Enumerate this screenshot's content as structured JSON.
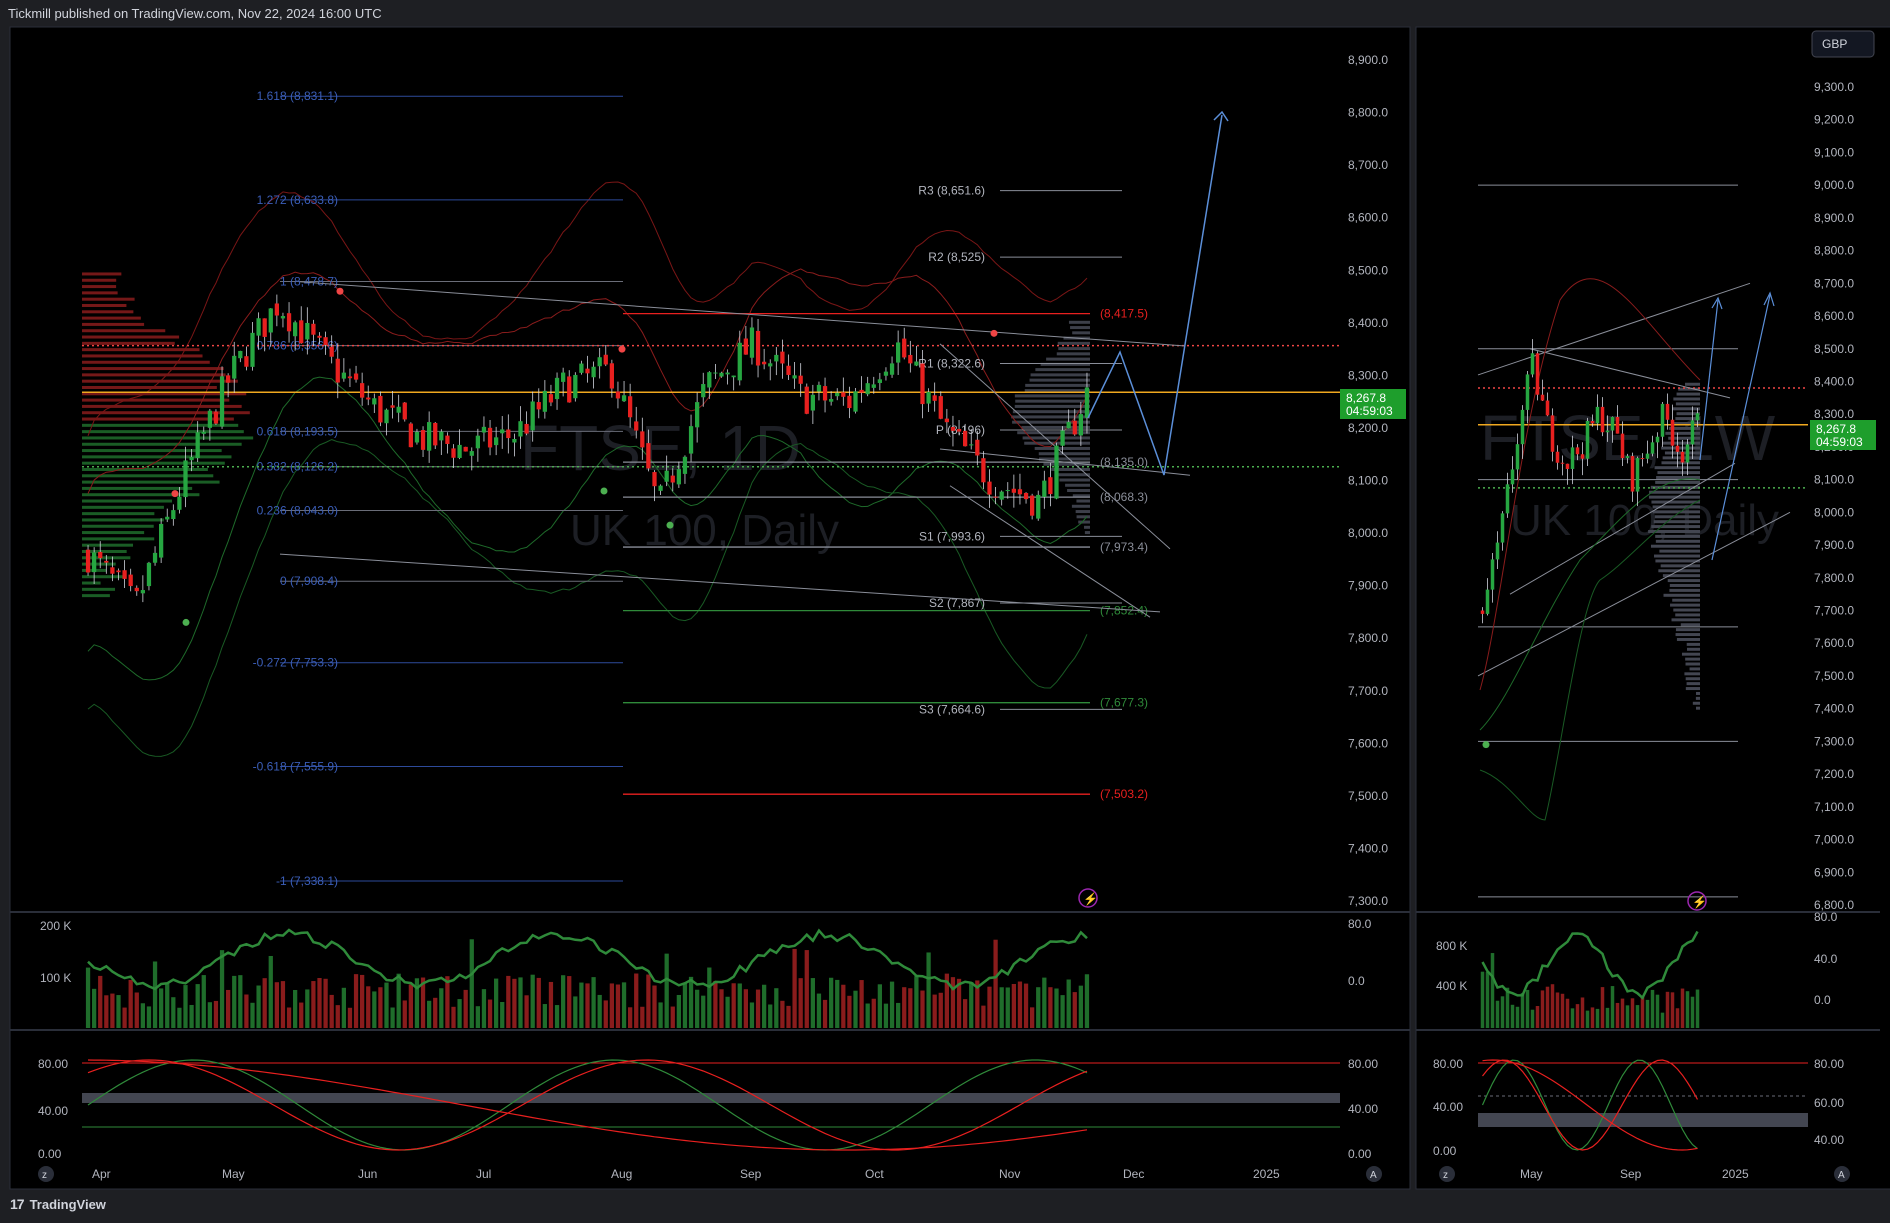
{
  "header": {
    "published": "Tickmill published on TradingView.com, Nov 22, 2024 16:00 UTC"
  },
  "footer": {
    "brand": "TradingView"
  },
  "colors": {
    "bg": "#000000",
    "panel_border": "#2a2e39",
    "up": "#26a641",
    "down": "#e8201f",
    "fib": "#3b5eb8",
    "pivot": "#b2b5be",
    "price_badge": "#1e9e2c",
    "orange_line": "#f0a81f",
    "red_dotted": "#f04545",
    "green_dotted": "#4caf50",
    "arrow_blue": "#5b8fd9"
  },
  "left": {
    "watermark_symbol": "FTSE, 1D",
    "watermark_name": "UK 100, Daily",
    "price_badge": {
      "price": "8,267.8",
      "time": "04:59:03"
    },
    "y_ticks": [
      "8,900.0",
      "8,800.0",
      "8,700.0",
      "8,600.0",
      "8,500.0",
      "8,400.0",
      "8,300.0",
      "8,200.0",
      "8,100.0",
      "8,000.0",
      "7,900.0",
      "7,800.0",
      "7,700.0",
      "7,600.0",
      "7,500.0",
      "7,400.0",
      "7,300.0"
    ],
    "x_ticks": [
      "Apr",
      "May",
      "Jun",
      "Jul",
      "Aug",
      "Sep",
      "Oct",
      "Nov",
      "Dec",
      "2025"
    ],
    "fib_levels": [
      {
        "label": "1.618 (8,831.1)",
        "price": 8831.1
      },
      {
        "label": "1.272 (8,633.8)",
        "price": 8633.8
      },
      {
        "label": "1 (8,478.7)",
        "price": 8478.7
      },
      {
        "label": "0.786 (8,356.6)",
        "price": 8356.6
      },
      {
        "label": "0.618 (8,193.5)",
        "price": 8193.5
      },
      {
        "label": "0.382 (8,126.2)",
        "price": 8126.2
      },
      {
        "label": "0.236 (8,043.0)",
        "price": 8043.0
      },
      {
        "label": "0 (7,908.4)",
        "price": 7908.4
      },
      {
        "label": "-0.272 (7,753.3)",
        "price": 7753.3
      },
      {
        "label": "-0.618 (7,555.9)",
        "price": 7555.9
      },
      {
        "label": "-1 (7,338.1)",
        "price": 7338.1
      }
    ],
    "pivots": [
      {
        "label": "R3 (8,651.6)",
        "price": 8651.6
      },
      {
        "label": "R2 (8,525)",
        "price": 8525
      },
      {
        "label": "R1 (8,322.6)",
        "price": 8322.6
      },
      {
        "label": "P (8,196)",
        "price": 8196
      },
      {
        "label": "S1 (7,993.6)",
        "price": 7993.6
      },
      {
        "label": "S2 (7,867)",
        "price": 7867
      },
      {
        "label": "S3 (7,664.6)",
        "price": 7664.6
      }
    ],
    "range_levels": [
      {
        "label": "(8,417.5)",
        "price": 8417.5,
        "color": "#e8201f"
      },
      {
        "label": "(8,135.0)",
        "price": 8135.0,
        "color": "#8a8e99"
      },
      {
        "label": "(8,068.3)",
        "price": 8068.3,
        "color": "#8a8e99"
      },
      {
        "label": "(7,973.4)",
        "price": 7973.4,
        "color": "#8a8e99"
      },
      {
        "label": "(7,852.4)",
        "price": 7852.4,
        "color": "#2f8a3a"
      },
      {
        "label": "(7,677.3)",
        "price": 7677.3,
        "color": "#2f8a3a"
      },
      {
        "label": "(7,503.2)",
        "price": 7503.2,
        "color": "#e8201f"
      }
    ],
    "volume_ticks": [
      "200 K",
      "100 K"
    ],
    "volume_osc_ticks": [
      "80.0",
      "0.0"
    ],
    "stoch_left_ticks": [
      "80.00",
      "40.00",
      "0.00"
    ],
    "stoch_right_ticks": [
      "80.00",
      "40.00",
      "0.00"
    ]
  },
  "right": {
    "currency": "GBP",
    "watermark_symbol": "FTSE, 1W",
    "watermark_name": "UK 100, Daily",
    "price_badge": {
      "price": "8,267.8",
      "time": "04:59:03"
    },
    "y_ticks": [
      "9,300.0",
      "9,200.0",
      "9,100.0",
      "9,000.0",
      "8,900.0",
      "8,800.0",
      "8,700.0",
      "8,600.0",
      "8,500.0",
      "8,400.0",
      "8,300.0",
      "8,200.0",
      "8,100.0",
      "8,000.0",
      "7,900.0",
      "7,800.0",
      "7,700.0",
      "7,600.0",
      "7,500.0",
      "7,400.0",
      "7,300.0",
      "7,200.0",
      "7,100.0",
      "7,000.0",
      "6,900.0",
      "6,800.0"
    ],
    "x_ticks": [
      "May",
      "Sep",
      "2025"
    ],
    "volume_ticks": [
      "800 K",
      "400 K"
    ],
    "volume_osc_ticks": [
      "80.0",
      "40.0",
      "0.0"
    ],
    "stoch_left_ticks": [
      "80.00",
      "40.00",
      "0.00"
    ],
    "stoch_right_ticks": [
      "80.00",
      "60.00",
      "40.00"
    ]
  },
  "chart_data": [
    {
      "type": "candlestick",
      "panel": "FTSE daily",
      "ylim": [
        7280,
        8940
      ],
      "grid": false,
      "levels": {
        "last": 8267.8,
        "orange_line": 8267.8,
        "red_dotted": 8356.6,
        "green_dotted": 8126.2
      },
      "close_path_approx": [
        {
          "x": "Apr",
          "y": 7960
        },
        {
          "x": "mid-Apr",
          "y": 7860
        },
        {
          "x": "late-Apr",
          "y": 8100
        },
        {
          "x": "May",
          "y": 8300
        },
        {
          "x": "mid-May",
          "y": 8440
        },
        {
          "x": "late-May",
          "y": 8330
        },
        {
          "x": "Jun",
          "y": 8240
        },
        {
          "x": "mid-Jun",
          "y": 8180
        },
        {
          "x": "Jul",
          "y": 8160
        },
        {
          "x": "mid-Jul",
          "y": 8190
        },
        {
          "x": "late-Jul",
          "y": 8280
        },
        {
          "x": "Aug",
          "y": 8310
        },
        {
          "x": "early-Aug",
          "y": 8050
        },
        {
          "x": "mid-Aug",
          "y": 8280
        },
        {
          "x": "Sep",
          "y": 8360
        },
        {
          "x": "mid-Sep",
          "y": 8260
        },
        {
          "x": "Oct",
          "y": 8250
        },
        {
          "x": "mid-Oct",
          "y": 8360
        },
        {
          "x": "late-Oct",
          "y": 8200
        },
        {
          "x": "Nov",
          "y": 8100
        },
        {
          "x": "mid-Nov",
          "y": 8060
        },
        {
          "x": "Nov 22",
          "y": 8267.8
        }
      ]
    },
    {
      "type": "candlestick",
      "panel": "FTSE weekly",
      "ylim": [
        6780,
        9360
      ],
      "grid": false,
      "levels": {
        "last": 8267.8
      }
    }
  ]
}
